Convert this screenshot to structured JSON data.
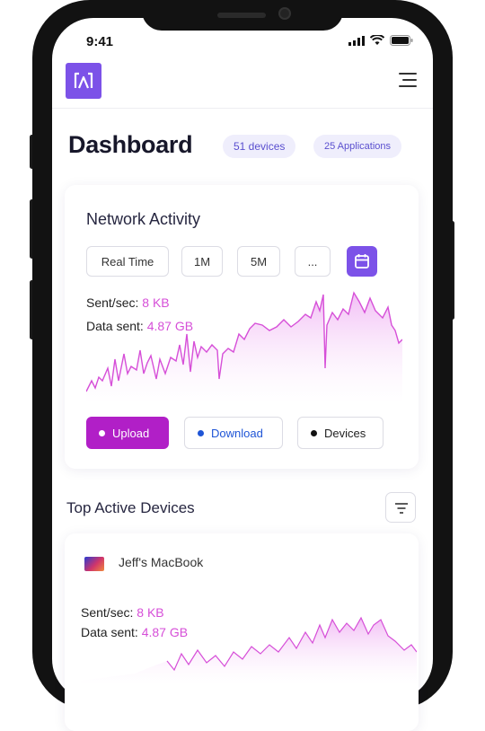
{
  "status_bar": {
    "time": "9:41"
  },
  "header": {
    "title": "Dashboard",
    "devices_chip": "51 devices",
    "apps_chip": "25 Applications"
  },
  "network": {
    "title": "Network Activity",
    "ranges": [
      "Real Time",
      "1M",
      "5M",
      "..."
    ],
    "sent_label": "Sent/sec:",
    "sent_value": "8 KB",
    "data_label": "Data sent:",
    "data_value": "4.87 GB",
    "legend": {
      "upload": "Upload",
      "download": "Download",
      "devices": "Devices"
    }
  },
  "top_devices": {
    "title": "Top Active Devices",
    "device": {
      "name": "Jeff's MacBook",
      "sent_label": "Sent/sec:",
      "sent_value": "8 KB",
      "data_label": "Data sent:",
      "data_value": "4.87 GB"
    }
  },
  "colors": {
    "accent": "#7c52e8",
    "upload": "#b11fc7",
    "download": "#1f55d6",
    "line": "#d64fd8",
    "fill": "#f5d9f7"
  },
  "icons": {
    "logo": "app-logo-icon",
    "menu": "hamburger-menu-icon",
    "calendar": "calendar-icon",
    "filter": "filter-icon",
    "device": "macbook-icon"
  }
}
